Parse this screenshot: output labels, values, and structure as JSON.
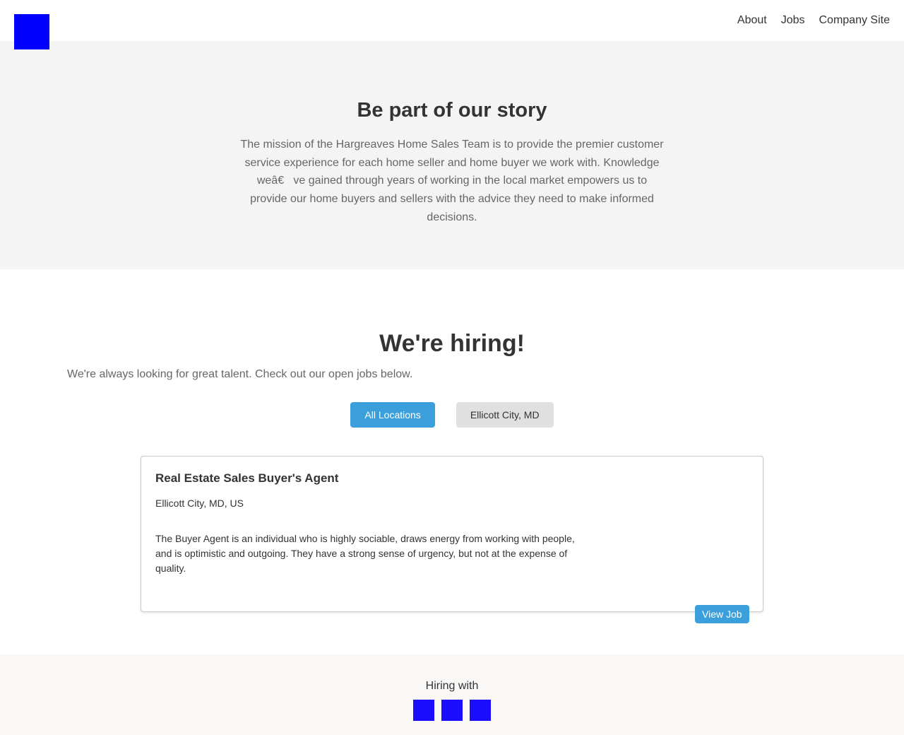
{
  "header": {
    "logo_icon": "company-logo",
    "logo_color": "#0000ff",
    "nav": [
      {
        "label": "About"
      },
      {
        "label": "Jobs"
      },
      {
        "label": "Company Site"
      }
    ]
  },
  "hero": {
    "title": "Be part of our story",
    "body": "The mission of the Hargreaves Home Sales Team is to provide the premier customer service experience for each home seller and home buyer we work with. Knowledge weâ€   ve gained through years of working in the local market empowers us to provide our home buyers and sellers with the advice they need to make informed decisions."
  },
  "hiring": {
    "title": "We're hiring!",
    "subtitle": "We're always looking for great talent. Check out our open jobs below.",
    "filters": [
      {
        "label": "All Locations",
        "active": true
      },
      {
        "label": "Ellicott City, MD",
        "active": false
      }
    ],
    "accent_color": "#3b9fdb"
  },
  "jobs": [
    {
      "title": "Real Estate Sales Buyer's Agent",
      "location": "Ellicott City, MD, US",
      "description": "The Buyer Agent is an individual who is highly sociable, draws energy from working with people, and is optimistic and outgoing. They have a strong sense of urgency, but not at the expense of quality.",
      "button_label": "View Job"
    }
  ],
  "footer": {
    "label": "Hiring with",
    "icons": [
      "partner-icon",
      "partner-icon",
      "partner-icon"
    ],
    "icon_color": "#1a0dff"
  }
}
